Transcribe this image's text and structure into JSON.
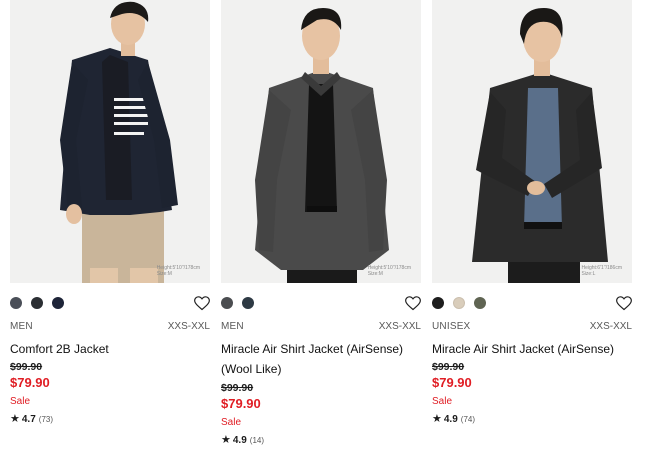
{
  "products": [
    {
      "photo_caption": [
        "Height:5'10\"/178cm",
        "Size:M"
      ],
      "swatches": [
        "#4a4f58",
        "#2b2e33",
        "#1e2438"
      ],
      "gender": "MEN",
      "sizes": "XXS-XXL",
      "name": "Comfort 2B Jacket",
      "original_price": "$99.90",
      "sale_price": "$79.90",
      "sale_label": "Sale",
      "rating": "4.7",
      "review_count": "(73)"
    },
    {
      "photo_caption": [
        "Height:5'10\"/178cm",
        "Size:M"
      ],
      "swatches": [
        "#4b4d50",
        "#2e3a44"
      ],
      "gender": "MEN",
      "sizes": "XXS-XXL",
      "name": "Miracle Air Shirt Jacket (AirSense)\n(Wool Like)",
      "original_price": "$99.90",
      "sale_price": "$79.90",
      "sale_label": "Sale",
      "rating": "4.9",
      "review_count": "(14)"
    },
    {
      "photo_caption": [
        "Height:6'1\"/186cm",
        "Size:L"
      ],
      "swatches": [
        "#1e1e1e",
        "#d9cdbb",
        "#5f6452"
      ],
      "gender": "UNISEX",
      "sizes": "XXS-XXL",
      "name": "Miracle Air Shirt Jacket (AirSense)",
      "original_price": "$99.90",
      "sale_price": "$79.90",
      "sale_label": "Sale",
      "rating": "4.9",
      "review_count": "(74)"
    }
  ],
  "icons": {
    "wishlist": "heart-outline-icon",
    "rating": "star-icon"
  },
  "colors": {
    "sale_red": "#e01d24",
    "text": "#1b1b1b",
    "muted": "#585858"
  }
}
